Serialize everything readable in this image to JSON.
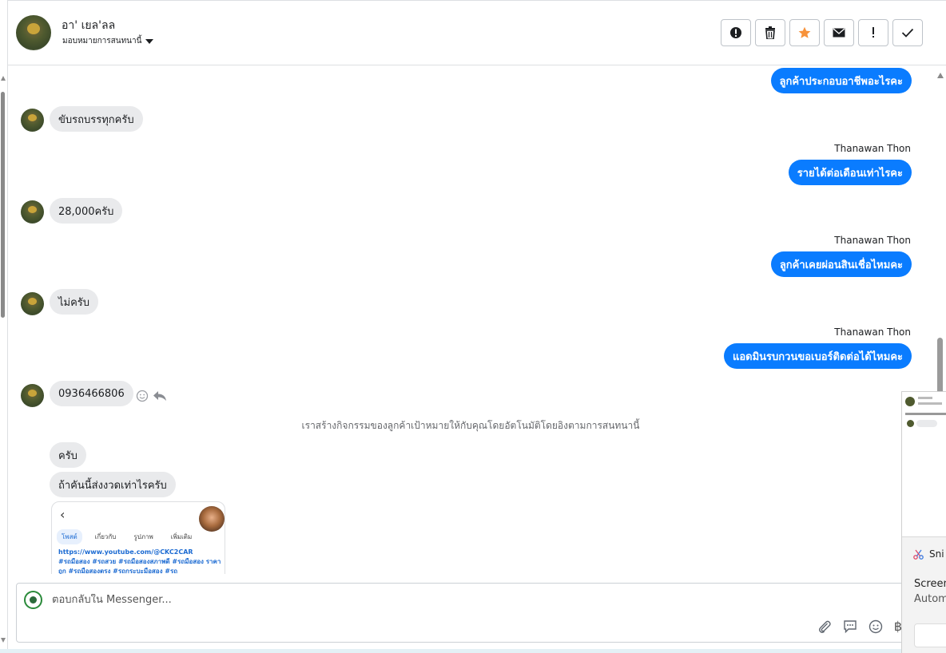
{
  "header": {
    "name": "อา' เยล'ลล",
    "assign_label": "มอบหมายการสนทนานี้",
    "toolbar": [
      {
        "icon": "alert-circle-icon",
        "label": "Report spam"
      },
      {
        "icon": "trash-icon",
        "label": "Delete"
      },
      {
        "icon": "star-icon",
        "label": "Star",
        "color": "#f7923a"
      },
      {
        "icon": "envelope-icon",
        "label": "Mark unread"
      },
      {
        "icon": "exclamation-icon",
        "label": "Follow up"
      },
      {
        "icon": "check-icon",
        "label": "Done"
      }
    ]
  },
  "messages": {
    "out1": "ลูกค้าประกอบอาชีพอะไรคะ",
    "in1": "ขับรถบรรทุกครับ",
    "sender2": "Thanawan Thon",
    "out2": "รายได้ต่อเดือนเท่าไรคะ",
    "in2": "28,000ครับ",
    "sender3": "Thanawan Thon",
    "out3": "ลูกค้าเคยผ่อนสินเชื่อไหมคะ",
    "in3": "ไม่ครับ",
    "sender4": "Thanawan Thon",
    "out4": "แอดมินรบกวนขอเบอร์ติดต่อได้ไหมคะ",
    "in4": "0936466806",
    "system_note": "เราสร้างกิจกรรมของลูกค้าเป้าหมายให้กับคุณโดยอัตโนมัติโดยอิงตามการสนทนานี้",
    "in5": "ครับ",
    "in6": "ถ้าคันนี้ส่งงวดเท่าไรครับ"
  },
  "attachment": {
    "tabs": [
      "โพสต์",
      "เกี่ยวกับ",
      "รูปภาพ",
      "เพิ่มเติม"
    ],
    "link": "https://www.youtube.com/@CKC2CAR",
    "hashtags": "#รถมือสอง #รถสวย #รถมือสองสภาพดี #รถมือสอง ราคาถูก #รถมือสองตรง #รถกระบะมือสอง #รถ"
  },
  "composer": {
    "placeholder": "ตอบกลับใน Messenger...",
    "currency_symbol": "฿"
  },
  "snip_popup": {
    "app_name": "Sni",
    "title": "Screen",
    "subtitle": "Autom"
  },
  "colors": {
    "outgoing_bubble": "#0a7cff",
    "incoming_bubble": "#e9eaec",
    "star": "#f7923a"
  }
}
